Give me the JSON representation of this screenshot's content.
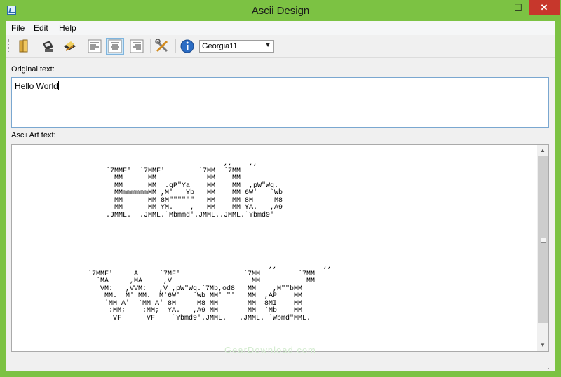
{
  "window": {
    "title": "Ascii Design",
    "minimize": "—",
    "maximize": "☐",
    "close": "✕"
  },
  "menu": [
    "File",
    "Edit",
    "Help"
  ],
  "toolbar": {
    "font_selector": "Georgia11",
    "selected_alignment": "center"
  },
  "original_text": {
    "label": "Original text:",
    "value": "Hello World"
  },
  "ascii_art": {
    "label": "Ascii Art text:",
    "line1": "                            ,,    ,,\n`7MMF'  `7MMF'        `7MM  `7MM\n  MM      MM            MM    MM\n  MM      MM  .gP\"Ya    MM    MM  ,pW\"Wq.\n  MMmmmmmmMM ,M'   Yb   MM    MM 6W'   `Wb\n  MM      MM 8M\"\"\"\"\"\"   MM    MM 8M     M8\n  MM      MM YM.    ,   MM    MM YA.   ,A9\n.JMML.  .JMML.`Mbmmd'.JMML..JMML.`Ybmd9'",
    "line2": "                                           ,,           ,,\n`7MMF'     A     `7MF'               `7MM         `7MM\n  `MA     ,MA     ,V                   MM           MM\n   VM:   ,VVM:   ,V ,pW\"Wq.`7Mb,od8   MM    ,M\"\"bMM\n    MM.  M' MM.  M'6W'   `Wb MM' \"'   MM  ,AP    MM\n    `MM A'  `MM A' 8M     M8 MM       MM  8MI    MM\n     :MM;    :MM;  YA.   ,A9 MM       MM  `Mb    MM\n      VF      VF    `Ybmd9'.JMML.   .JMML. `Wbmd\"MML."
  },
  "watermark": "GearDownload.com",
  "icons": [
    "app-icon",
    "open-icon",
    "save-icon",
    "print-icon",
    "align-left-icon",
    "align-center-icon",
    "align-right-icon",
    "settings-icon",
    "info-icon"
  ],
  "colors": {
    "frame": "#7cc243",
    "close": "#c7372c",
    "selected_button": "#cde6f7"
  }
}
